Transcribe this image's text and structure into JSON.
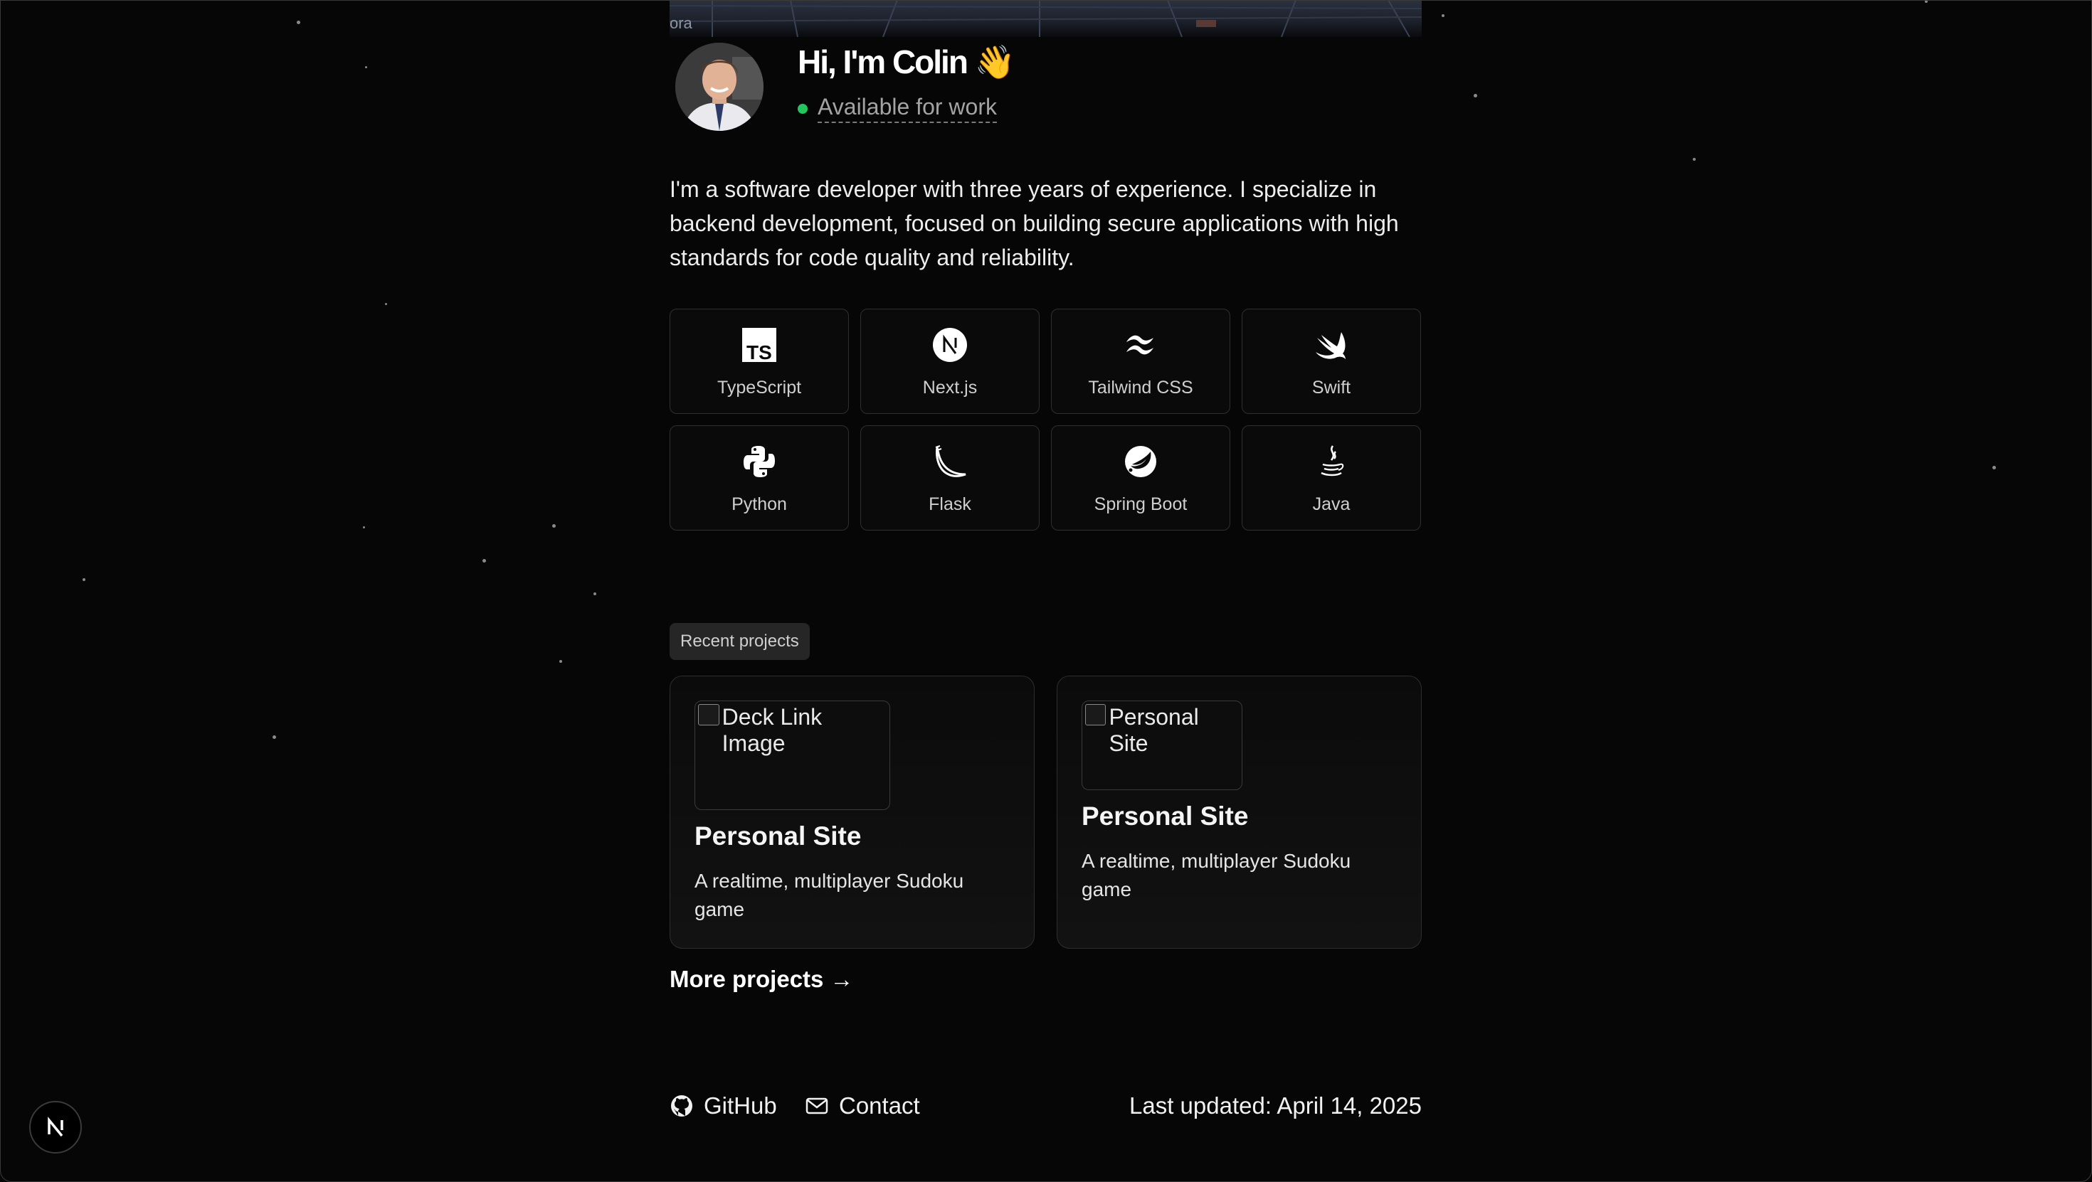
{
  "map": {
    "place_label": "ora"
  },
  "header": {
    "greeting": "Hi, I'm Colin 👋",
    "status": "Available for work",
    "status_color": "#22c55e"
  },
  "bio": "I'm a software developer with three years of experience. I specialize in backend development, focused on building secure applications with high standards for code quality and reliability.",
  "tech": [
    {
      "label": "TypeScript",
      "icon": "typescript-icon"
    },
    {
      "label": "Next.js",
      "icon": "nextjs-icon"
    },
    {
      "label": "Tailwind CSS",
      "icon": "tailwind-icon"
    },
    {
      "label": "Swift",
      "icon": "swift-icon"
    },
    {
      "label": "Python",
      "icon": "python-icon"
    },
    {
      "label": "Flask",
      "icon": "flask-icon"
    },
    {
      "label": "Spring Boot",
      "icon": "spring-boot-icon"
    },
    {
      "label": "Java",
      "icon": "java-icon"
    }
  ],
  "projects": {
    "badge": "Recent projects",
    "items": [
      {
        "image_alt": "Deck Link Image",
        "title": "Personal Site",
        "description": "A realtime, multiplayer Sudoku game"
      },
      {
        "image_alt": "Personal Site",
        "title": "Personal Site",
        "description": "A realtime, multiplayer Sudoku game"
      }
    ],
    "more_link": "More projects →"
  },
  "footer": {
    "github": "GitHub",
    "contact": "Contact",
    "last_updated": "Last updated: April 14, 2025"
  },
  "dev_badge": {
    "icon": "nextjs-dev-icon"
  }
}
